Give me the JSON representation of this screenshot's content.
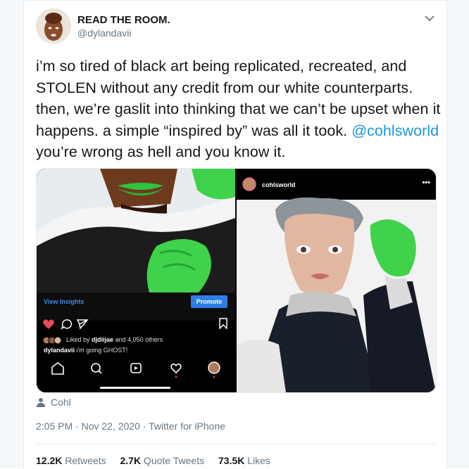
{
  "tweet": {
    "display_name": "READ THE ROOM.",
    "handle": "@dylandavii",
    "text_before": "i’m so tired of black art being replicated, recreated, and STOLEN without any credit from our white counterparts. then, we’re gaslit into thinking that we can’t be upset when it happens. a simple “inspired by” was all it took.",
    "mention": "@cohlsworld",
    "text_after": " you’re wrong as hell and you know it.",
    "tagged": "Cohl",
    "time": "2:05 PM",
    "date": "Nov 22, 2020",
    "source": "Twitter for iPhone",
    "separator": "·",
    "retweets_count": "12.2K",
    "retweets_label": "Retweets",
    "quotes_count": "2.7K",
    "quotes_label": "Quote Tweets",
    "likes_count": "73.5K",
    "likes_label": "Likes"
  },
  "left_image": {
    "view_insights": "View Insights",
    "promote": "Promote",
    "liked_prefix": "Liked by",
    "liked_user": "djdiijae",
    "liked_suffix": "and 4,050 others",
    "caption_user": "dylandavii",
    "caption_text": "i'm going GHOST!"
  },
  "right_image": {
    "account": "cohlsworld",
    "menu": "•••"
  },
  "colors": {
    "link": "#1b95e0",
    "secondary_text": "#657786",
    "primary_text": "#14171a",
    "instagram_blue": "#2f7de6",
    "slime_green": "#3fd24a"
  }
}
